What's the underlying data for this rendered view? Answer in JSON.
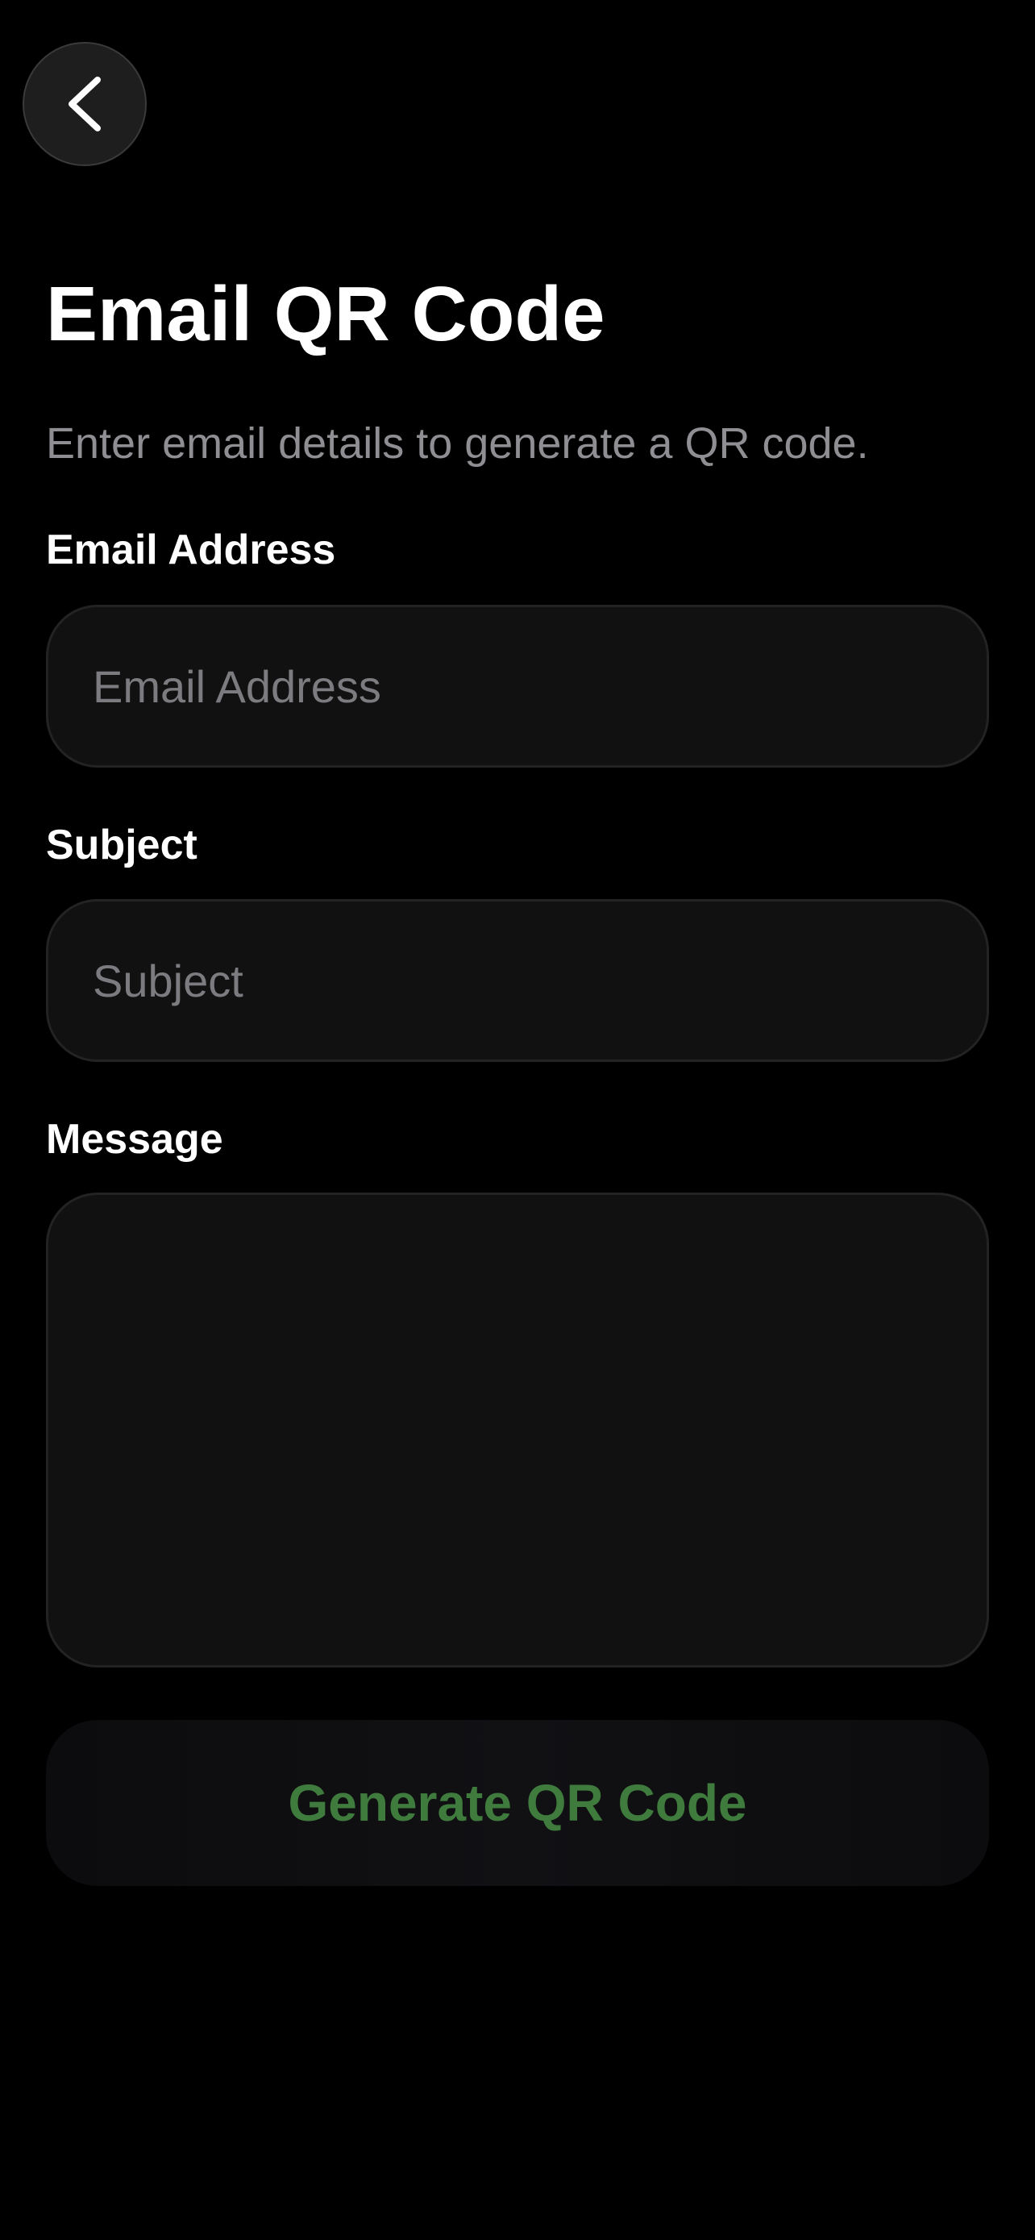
{
  "header": {
    "back_icon": "chevron-left-icon"
  },
  "page": {
    "title": "Email QR Code",
    "subtitle": "Enter email details to generate a QR code."
  },
  "form": {
    "email": {
      "label": "Email Address",
      "placeholder": "Email Address",
      "value": ""
    },
    "subject": {
      "label": "Subject",
      "placeholder": "Subject",
      "value": ""
    },
    "message": {
      "label": "Message",
      "value": ""
    },
    "submit_label": "Generate QR Code"
  },
  "colors": {
    "background": "#000000",
    "field_background": "#111111",
    "accent_green": "#3f7b3d",
    "muted_text": "#8e8e93"
  }
}
